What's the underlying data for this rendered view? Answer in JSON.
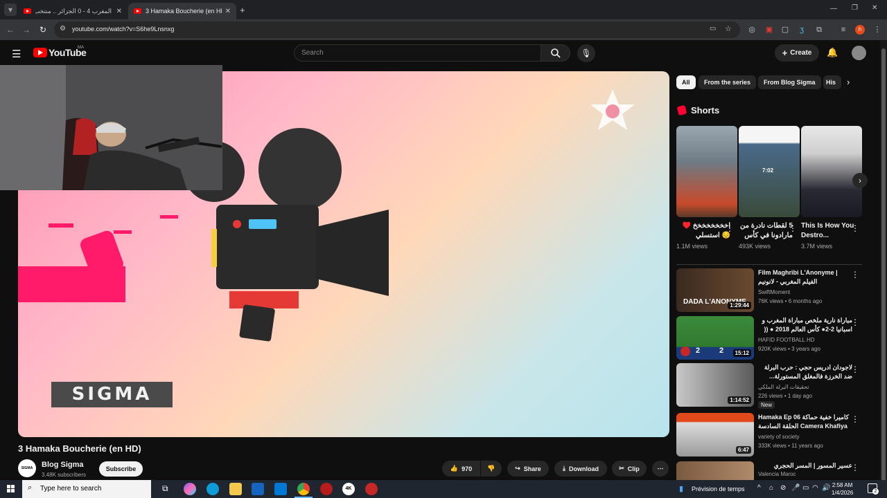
{
  "browser": {
    "tabs": [
      {
        "title": "المغرب 4 - 0 الجزائر .. منتخب الأمة",
        "active": false
      },
      {
        "title": "3 Hamaka Boucherie (en HD) -",
        "active": true
      }
    ],
    "url": "youtube.com/watch?v=S6he9Lnsnxg"
  },
  "youtube": {
    "logo_text": "YouTube",
    "region": "MA",
    "search_placeholder": "Search",
    "create_label": "Create"
  },
  "video": {
    "title": "3 Hamaka Boucherie (en HD)",
    "overlay_text": "SIGMA",
    "channel": "Blog Sigma",
    "channel_avatar_text": "SIGMA",
    "subscribers": "3.48K subscribers",
    "subscribe_label": "Subscribe",
    "likes": "970",
    "share_label": "Share",
    "download_label": "Download",
    "clip_label": "Clip"
  },
  "sidebar": {
    "chips": [
      "All",
      "From the series",
      "From Blog Sigma",
      "His"
    ],
    "shorts_heading": "Shorts",
    "shorts": [
      {
        "title": "اخخخخخخخخ ♥️😔 استسلي",
        "views": "1.1M views"
      },
      {
        "title": "5 لقطات نادرة من مارادونا في كأس",
        "views": "493K views",
        "overlay": "7:02"
      },
      {
        "title": "This Is How You Destro...",
        "views": "3.7M views"
      }
    ],
    "recommendations": [
      {
        "title": "Film Maghribi L'Anonyme | الفيلم المغربي - لانونيم",
        "channel": "SwiftMoment",
        "meta": "76K views • 6 months ago",
        "duration": "1:29:44",
        "thumb_text": "DADA L'ANONYME"
      },
      {
        "title": "مباراة نارية ملخص مباراة المغرب و اسبانيا 2-2● كأس العالم 2018 ● (( جواد بدة ))",
        "channel": "HAFID FOOTBALL HD",
        "meta": "920K views • 3 years ago",
        "duration": "15:12",
        "score_left": "2",
        "score_right": "2"
      },
      {
        "title": "لاجودان ادريس حجي : حرب البرلة ضد الخرزة فالمغلق المستورلة... كيفاش طيحنا",
        "channel": "تحقيقات البرلة الملكي",
        "meta": "226 views • 1 day ago",
        "duration": "1:14:52",
        "badge": "New"
      },
      {
        "title": "Hamaka Ep 06 كاميرا خفية حماكة الحلقة السادسة Camera Khafiya Hamak...",
        "channel": "variety of society",
        "meta": "333K views • 11 years ago",
        "duration": "6:47"
      },
      {
        "title": "عسير المسور | المسر الحجري",
        "channel": "Valencia Maroc",
        "meta": "",
        "duration": ""
      }
    ]
  },
  "taskbar": {
    "search_placeholder": "Type here to search",
    "weather": "Prévision de temps",
    "time": "2:58 AM",
    "date": "1/4/2026",
    "notification_count": "2"
  },
  "colors": {
    "bg": "#0f0f0f",
    "yt_red": "#ff0000",
    "chip_bg": "#272727",
    "text_secondary": "#aaaaaa"
  }
}
